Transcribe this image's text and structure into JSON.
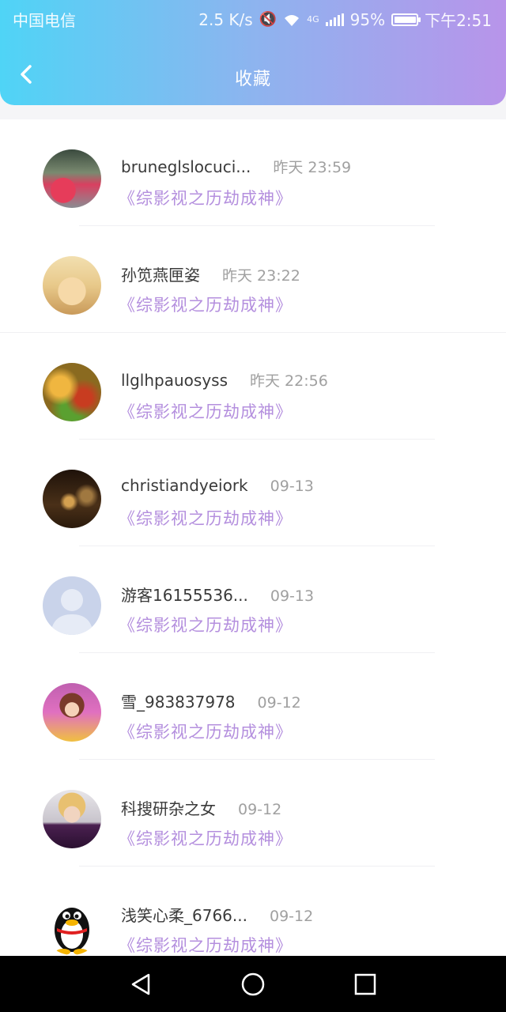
{
  "status_bar": {
    "carrier": "中国电信",
    "net_speed": "2.5 K/s",
    "network_type": "4G",
    "battery": "95%",
    "time": "下午2:51",
    "icons": [
      "mute-icon",
      "wifi-icon",
      "signal-icon",
      "battery-icon"
    ]
  },
  "header": {
    "title": "收藏",
    "back_icon": "chevron-left-icon",
    "colors": {
      "gradient_start": "#4fd4f6",
      "gradient_end": "#b894ea"
    }
  },
  "accent_color": "#b48fde",
  "items": [
    {
      "name": "bruneglslocuci...",
      "time": "昨天 23:59",
      "book": "《综影视之历劫成神》",
      "avatar": "car-photo"
    },
    {
      "name": "孙笕燕匣姿",
      "time": "昨天 23:22",
      "book": "《综影视之历劫成神》",
      "avatar": "anime-girl-sunglasses"
    },
    {
      "name": "llglhpauosyss",
      "time": "昨天 22:56",
      "book": "《综影视之历劫成神》",
      "avatar": "bokeh-lights"
    },
    {
      "name": "christiandyeiork",
      "time": "09-13",
      "book": "《综影视之历劫成神》",
      "avatar": "chess-pieces"
    },
    {
      "name": "游客16155536...",
      "time": "09-13",
      "book": "《综影视之历劫成神》",
      "avatar": "default-user"
    },
    {
      "name": "雪_983837978",
      "time": "09-12",
      "book": "《综影视之历劫成神》",
      "avatar": "cartoon-girl"
    },
    {
      "name": "科搜研杂之女",
      "time": "09-12",
      "book": "《综影视之历劫成神》",
      "avatar": "portrait-man"
    },
    {
      "name": "浅笑心柔_6766...",
      "time": "09-12",
      "book": "《综影视之历劫成神》",
      "avatar": "qq-penguin"
    }
  ],
  "nav_bar": {
    "icons": [
      "back-triangle-icon",
      "home-circle-icon",
      "recents-square-icon"
    ]
  }
}
